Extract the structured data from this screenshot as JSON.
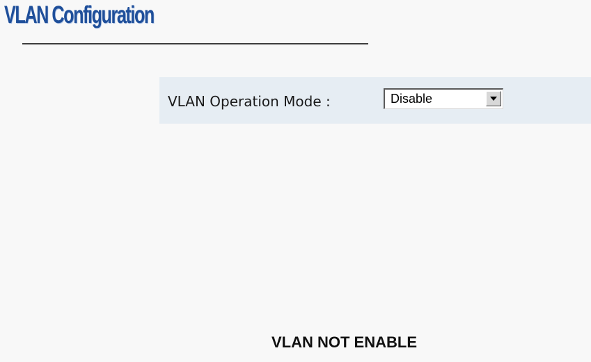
{
  "page": {
    "title": "VLAN Configuration"
  },
  "mode": {
    "label": "VLAN Operation Mode :",
    "selected": "Disable",
    "dropdown_icon": "chevron-down-icon"
  },
  "status": {
    "message": "VLAN NOT ENABLE"
  },
  "colors": {
    "title": "#1f4f9a",
    "panel_background": "#e6edf3",
    "page_background": "#f8f8f8"
  }
}
